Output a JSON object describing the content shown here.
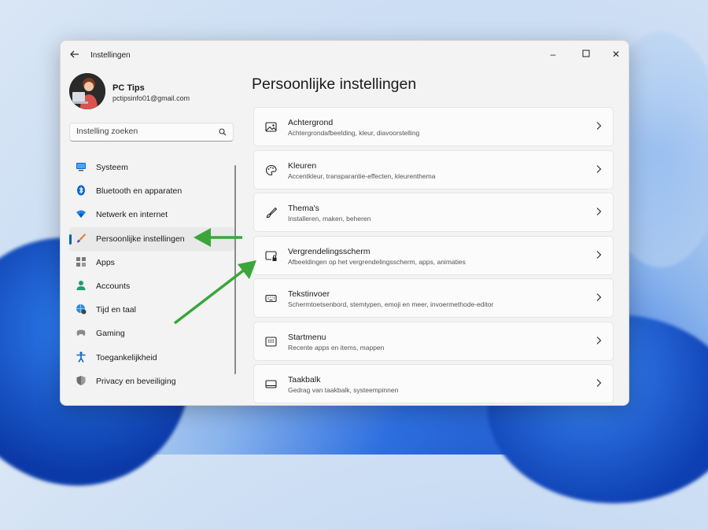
{
  "colors": {
    "accent": "#005fb8",
    "annotation_arrow": "#3aa63a"
  },
  "window": {
    "title": "Instellingen",
    "back_icon": "arrow-left-icon",
    "controls": {
      "minimize": "–",
      "maximize": "☐",
      "close": "✕"
    }
  },
  "user": {
    "name": "PC Tips",
    "email": "pctipsinfo01@gmail.com"
  },
  "search": {
    "placeholder": "Instelling zoeken",
    "icon": "search-icon"
  },
  "sidebar": {
    "items": [
      {
        "label": "Systeem",
        "icon": "monitor-icon",
        "active": false
      },
      {
        "label": "Bluetooth en apparaten",
        "icon": "bluetooth-icon",
        "active": false
      },
      {
        "label": "Netwerk en internet",
        "icon": "wifi-icon",
        "active": false
      },
      {
        "label": "Persoonlijke instellingen",
        "icon": "paintbrush-icon",
        "active": true
      },
      {
        "label": "Apps",
        "icon": "apps-icon",
        "active": false
      },
      {
        "label": "Accounts",
        "icon": "person-icon",
        "active": false
      },
      {
        "label": "Tijd en taal",
        "icon": "globe-clock-icon",
        "active": false
      },
      {
        "label": "Gaming",
        "icon": "gamepad-icon",
        "active": false
      },
      {
        "label": "Toegankelijkheid",
        "icon": "accessibility-icon",
        "active": false
      },
      {
        "label": "Privacy en beveiliging",
        "icon": "shield-icon",
        "active": false
      }
    ]
  },
  "main": {
    "title": "Persoonlijke instellingen",
    "cards": [
      {
        "title": "Achtergrond",
        "desc": "Achtergrondafbeelding, kleur, diavoorstelling",
        "icon": "image-icon"
      },
      {
        "title": "Kleuren",
        "desc": "Accentkleur, transparantie-effecten, kleurenthema",
        "icon": "palette-icon"
      },
      {
        "title": "Thema's",
        "desc": "Installeren, maken, beheren",
        "icon": "brush-icon"
      },
      {
        "title": "Vergrendelingsscherm",
        "desc": "Afbeeldingen op het vergrendelingsscherm, apps, animaties",
        "icon": "lock-screen-icon"
      },
      {
        "title": "Tekstinvoer",
        "desc": "Schermtoetsenbord, stemtypen, emoji en meer, invoermethode-editor",
        "icon": "keyboard-icon"
      },
      {
        "title": "Startmenu",
        "desc": "Recente apps en items, mappen",
        "icon": "start-menu-icon"
      },
      {
        "title": "Taakbalk",
        "desc": "Gedrag van taakbalk, systeempinnen",
        "icon": "taskbar-icon"
      }
    ]
  }
}
